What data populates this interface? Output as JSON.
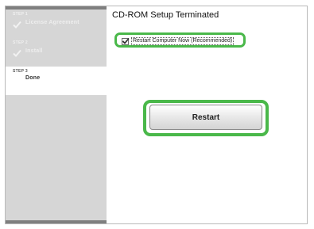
{
  "steps": [
    {
      "number": "STEP 1",
      "label": "License Agreement",
      "completed": true
    },
    {
      "number": "STEP 2",
      "label": "Install",
      "completed": true
    },
    {
      "number": "STEP 3",
      "label": "Done",
      "completed": false
    }
  ],
  "main": {
    "title": "CD-ROM Setup Terminated",
    "checkbox": {
      "label": "Restart Computer Now (Recommended)",
      "checked": true
    },
    "restart_button_label": "Restart"
  },
  "colors": {
    "highlight": "#4ab84a",
    "sidebar": "#d6d6d6",
    "sidebar_bar": "#7f7f7f"
  }
}
